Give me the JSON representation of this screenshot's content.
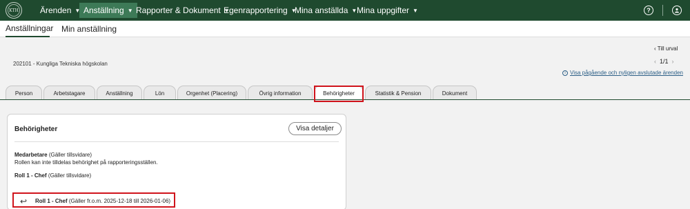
{
  "topnav": {
    "logo_text": "KTH",
    "items": [
      {
        "label": "Ärenden"
      },
      {
        "label": "Anställning"
      },
      {
        "label": "Rapporter & Dokument"
      },
      {
        "label": "Egenrapportering"
      },
      {
        "label": "Mina anställda"
      },
      {
        "label": "Mina uppgifter"
      }
    ],
    "help_icon": "?",
    "user_icon": "person"
  },
  "subnav": {
    "tabs": [
      {
        "label": "Anställningar"
      },
      {
        "label": "Min anställning"
      }
    ]
  },
  "header": {
    "org": "202101 - Kungliga Tekniska högskolan",
    "till_urval": "Till urval",
    "pager": "1/1",
    "visa_link": "Visa pågående och nyligen avslutade ärenden"
  },
  "tabs": [
    {
      "label": "Person"
    },
    {
      "label": "Arbetstagare"
    },
    {
      "label": "Anställning"
    },
    {
      "label": "Lön"
    },
    {
      "label": "Orgenhet (Placering)"
    },
    {
      "label": "Övrig information"
    },
    {
      "label": "Behörigheter"
    },
    {
      "label": "Statistik & Pension"
    },
    {
      "label": "Dokument"
    }
  ],
  "card": {
    "title": "Behörigheter",
    "details_button": "Visa detaljer",
    "medarbetare_role": "Medarbetare",
    "medarbetare_validity": "(Gäller tillsvidare)",
    "medarbetare_note": "Rollen kan inte tilldelas behörighet på rapporteringsställen.",
    "roll1_role": "Roll 1 - Chef",
    "roll1_validity": "(Gäller tillsvidare)",
    "roll1_hist_role": "Roll 1 - Chef",
    "roll1_hist_validity": "(Gäller fr.o.m. 2025-12-18 till 2026-01-06)"
  },
  "colors": {
    "nav_bg": "#1f4a2f",
    "nav_active": "#3d7a57",
    "highlight": "#d0131b",
    "link": "#2b5e86"
  }
}
